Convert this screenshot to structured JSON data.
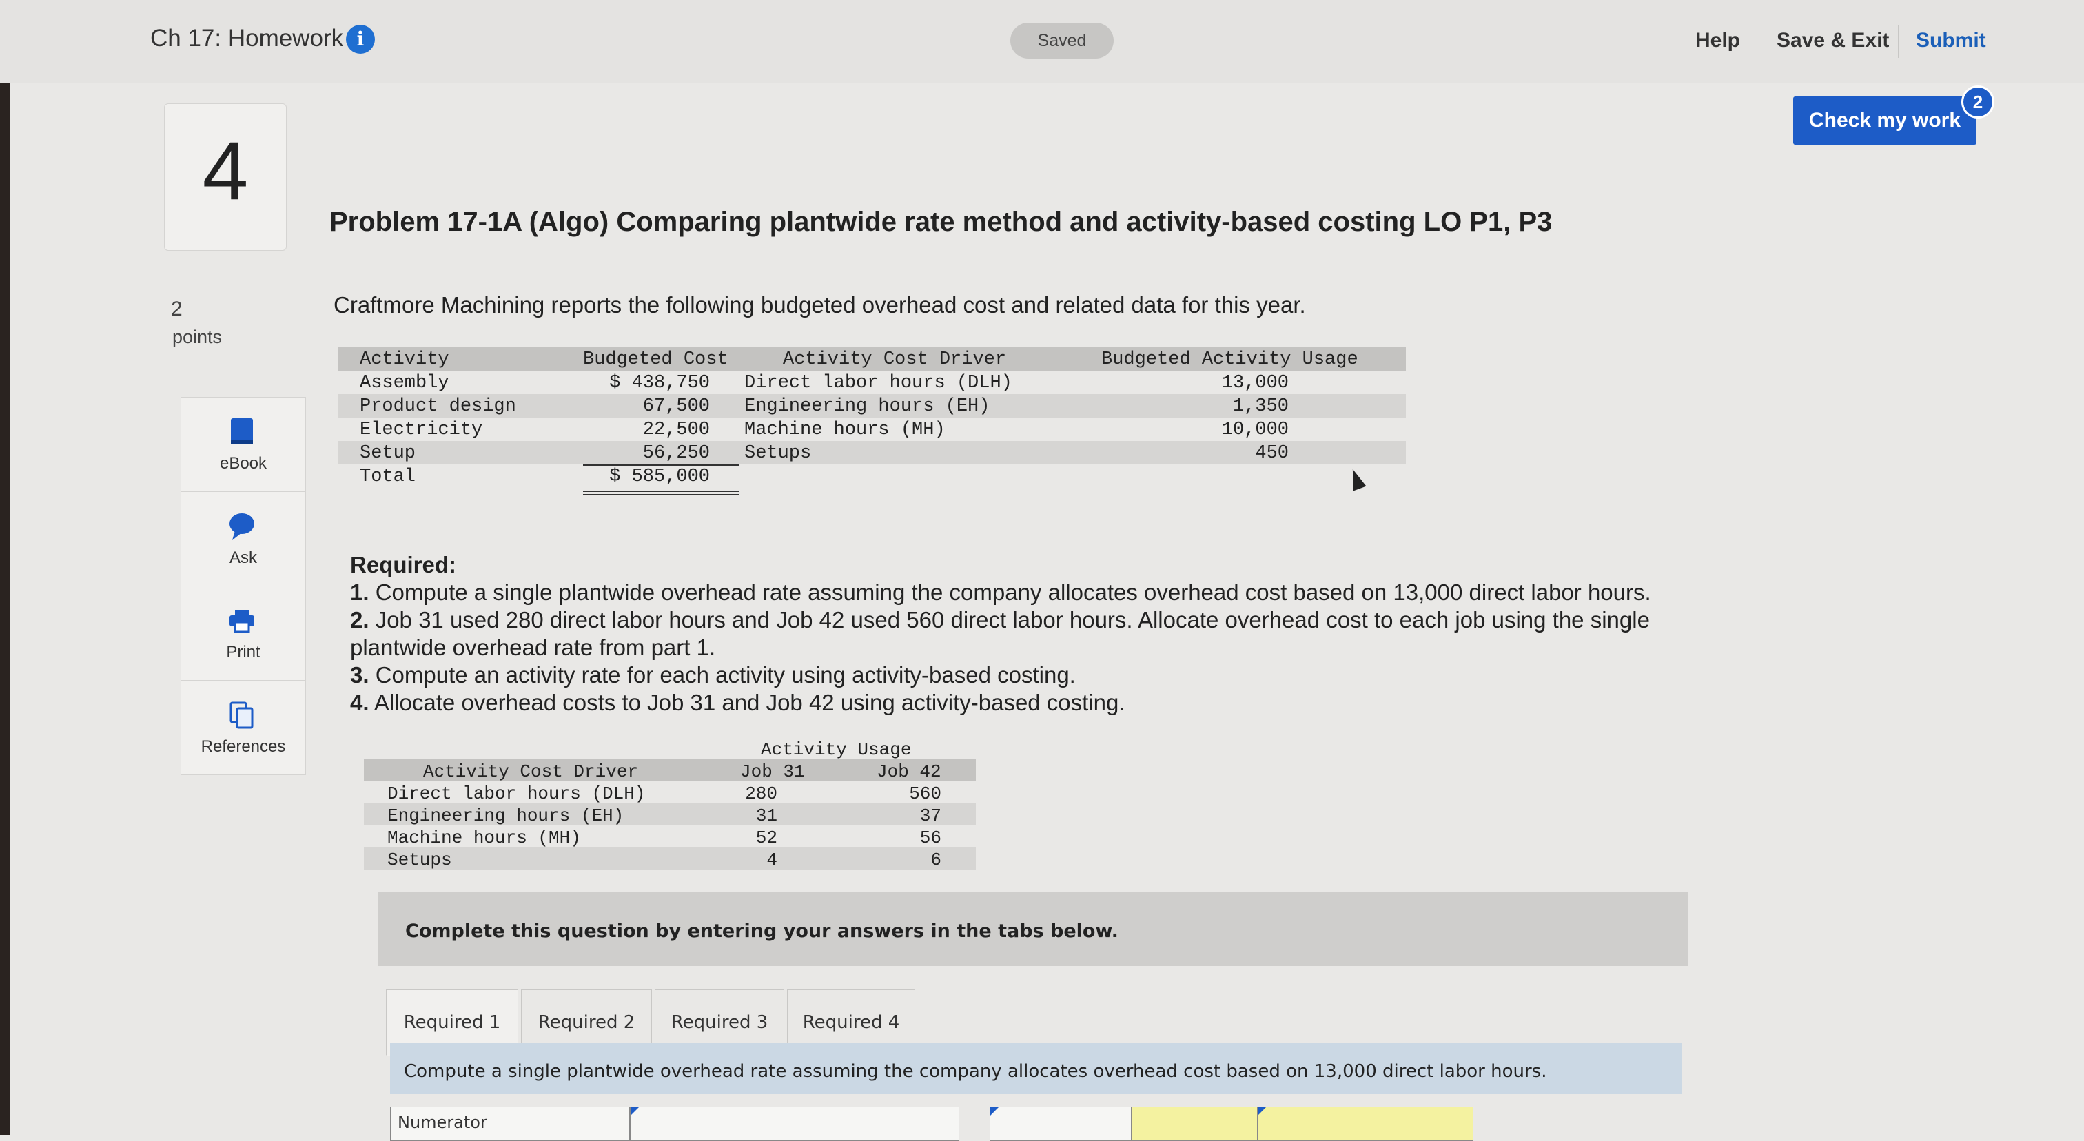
{
  "header": {
    "assignment_title": "Ch 17: Homework",
    "saved_status": "Saved",
    "help_label": "Help",
    "save_exit_label": "Save & Exit",
    "submit_label": "Submit",
    "check_work_label": "Check my work",
    "check_work_badge": "2"
  },
  "question": {
    "number": "4",
    "title": "Problem 17-1A (Algo) Comparing plantwide rate method and activity-based costing LO P1, P3",
    "points_value": "2",
    "points_label": "points",
    "intro": "Craftmore Machining reports the following budgeted overhead cost and related data for this year."
  },
  "sidebar": {
    "items": [
      {
        "label": "eBook",
        "icon": "book-icon"
      },
      {
        "label": "Ask",
        "icon": "chat-bubble-icon"
      },
      {
        "label": "Print",
        "icon": "printer-icon"
      },
      {
        "label": "References",
        "icon": "copy-icon"
      }
    ]
  },
  "budget_table": {
    "headers": [
      "Activity",
      "Budgeted Cost",
      "Activity Cost Driver",
      "Budgeted Activity Usage"
    ],
    "rows": [
      {
        "activity": "Assembly",
        "cost": "$ 438,750",
        "driver": "Direct labor hours (DLH)",
        "usage": "13,000"
      },
      {
        "activity": "Product design",
        "cost": "67,500",
        "driver": "Engineering hours (EH)",
        "usage": "1,350"
      },
      {
        "activity": "Electricity",
        "cost": "22,500",
        "driver": "Machine hours (MH)",
        "usage": "10,000"
      },
      {
        "activity": "Setup",
        "cost": "56,250",
        "driver": "Setups",
        "usage": "450"
      }
    ],
    "total_label": "Total",
    "total_value": "$ 585,000"
  },
  "required": {
    "title": "Required:",
    "items": [
      {
        "num": "1.",
        "text": " Compute a single plantwide overhead rate assuming the company allocates overhead cost based on 13,000 direct labor hours."
      },
      {
        "num": "2.",
        "text": " Job 31 used 280 direct labor hours and Job 42 used 560 direct labor hours. Allocate overhead cost to each job using the single plantwide overhead rate from part 1."
      },
      {
        "num": "3.",
        "text": " Compute an activity rate for each activity using activity-based costing."
      },
      {
        "num": "4.",
        "text": " Allocate overhead costs to Job 31 and Job 42 using activity-based costing."
      }
    ]
  },
  "usage_table": {
    "group_header": "Activity Usage",
    "headers": [
      "Activity Cost Driver",
      "Job 31",
      "Job 42"
    ],
    "rows": [
      {
        "driver": "Direct labor hours (DLH)",
        "job31": "280",
        "job42": "560"
      },
      {
        "driver": "Engineering hours (EH)",
        "job31": "31",
        "job42": "37"
      },
      {
        "driver": "Machine hours (MH)",
        "job31": "52",
        "job42": "56"
      },
      {
        "driver": "Setups",
        "job31": "4",
        "job42": "6"
      }
    ]
  },
  "answer_area": {
    "panel_text": "Complete this question by entering your answers in the tabs below.",
    "tabs": [
      "Required 1",
      "Required 2",
      "Required 3",
      "Required 4"
    ],
    "active_tab": "Required 1",
    "instruction": "Compute a single plantwide overhead rate assuming the company allocates overhead cost based on 13,000 direct labor hours.",
    "first_cell_label": "Numerator"
  },
  "colors": {
    "accent_blue": "#1d5cc7",
    "instruction_bg": "#cbd8e4",
    "answer_cell_yellow": "#f4f2a0"
  }
}
